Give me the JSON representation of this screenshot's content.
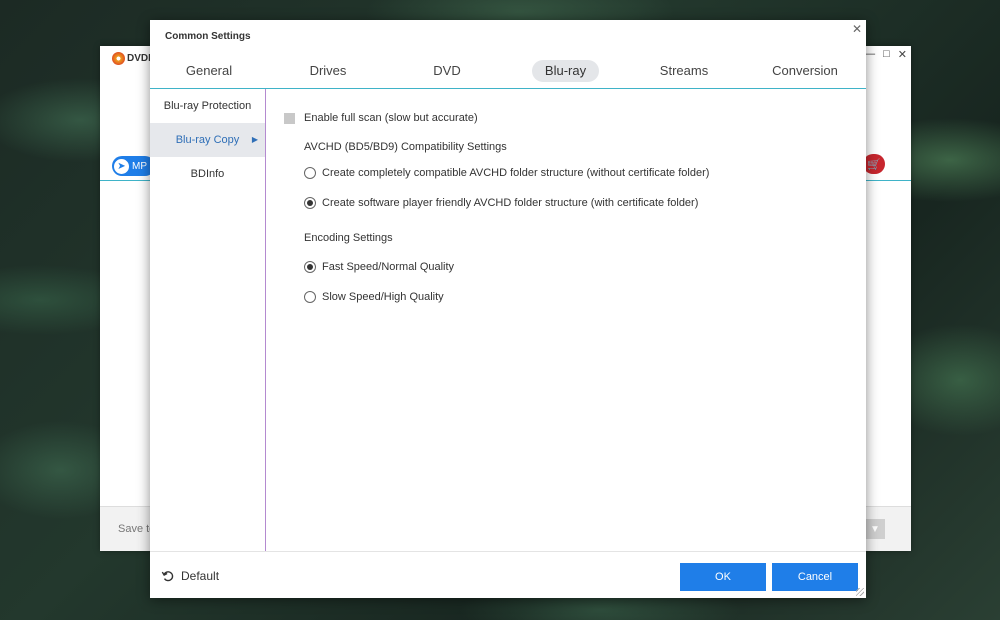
{
  "background_app": {
    "logo_text": "DVDI",
    "tab_label": "MP",
    "save_label": "Save to",
    "window_controls": [
      "minimize-icon",
      "maximize-icon",
      "close-icon"
    ]
  },
  "dialog": {
    "title": "Common Settings",
    "tabs": [
      {
        "label": "General"
      },
      {
        "label": "Drives"
      },
      {
        "label": "DVD"
      },
      {
        "label": "Blu-ray",
        "active": true
      },
      {
        "label": "Streams"
      },
      {
        "label": "Conversion"
      }
    ],
    "sidebar": [
      {
        "label": "Blu-ray Protection"
      },
      {
        "label": "Blu-ray Copy",
        "active": true
      },
      {
        "label": "BDInfo"
      }
    ],
    "content": {
      "full_scan_label": "Enable full scan (slow but accurate)",
      "full_scan_checked": false,
      "avchd_section": "AVCHD (BD5/BD9) Compatibility Settings",
      "avchd_options": [
        {
          "label": "Create completely compatible AVCHD folder structure (without certificate folder)",
          "selected": false
        },
        {
          "label": "Create software player friendly AVCHD folder structure (with certificate folder)",
          "selected": true
        }
      ],
      "encoding_section": "Encoding Settings",
      "encoding_options": [
        {
          "label": "Fast Speed/Normal Quality",
          "selected": true
        },
        {
          "label": "Slow Speed/High Quality",
          "selected": false
        }
      ]
    },
    "footer": {
      "default_label": "Default",
      "ok_label": "OK",
      "cancel_label": "Cancel"
    }
  },
  "colors": {
    "accent": "#1f7ee8",
    "divider": "#3fb3c8",
    "active_tab_bg": "#e4e6e9",
    "sidebar_active_text": "#2f6fb7"
  }
}
